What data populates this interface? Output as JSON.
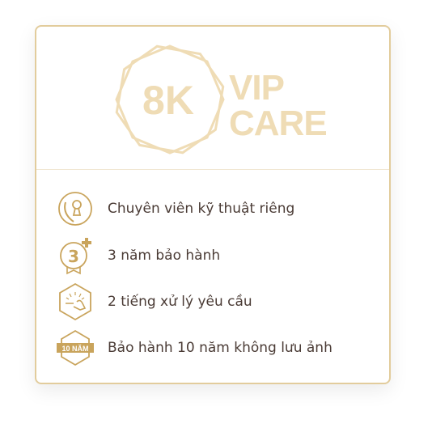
{
  "logo": {
    "badge": "8K",
    "line1": "VIP",
    "line2": "CARE"
  },
  "features": [
    {
      "icon": "phone-keyhole-icon",
      "label": "Chuyên viên kỹ thuật riêng"
    },
    {
      "icon": "three-plus-medal-icon",
      "label": "3 năm bảo hành"
    },
    {
      "icon": "hand-hexagon-icon",
      "label": "2 tiếng xử lý yêu cầu"
    },
    {
      "icon": "ten-year-hexagon-icon",
      "label": "Bảo hành 10 năm không lưu ảnh",
      "badge_text": "10 NĂM"
    }
  ],
  "colors": {
    "gold": "#c9a45c",
    "logo": "#efdcb5",
    "text": "#4a3b35"
  }
}
